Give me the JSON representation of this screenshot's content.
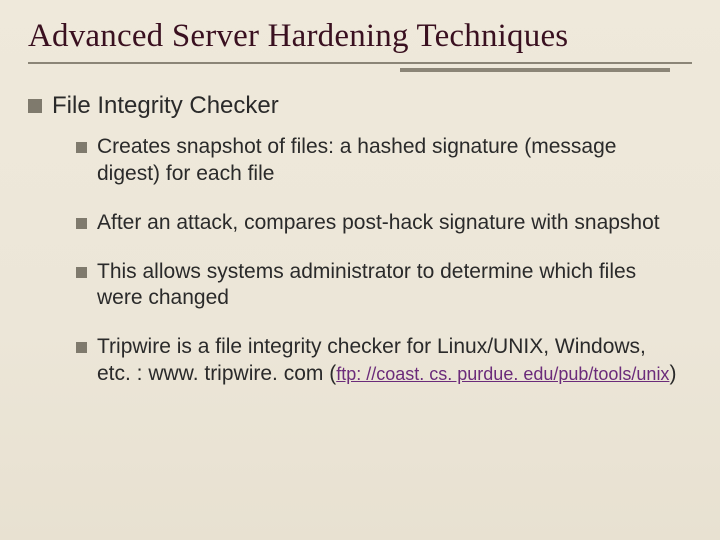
{
  "slide": {
    "title": "Advanced Server Hardening Techniques",
    "topic": "File Integrity Checker",
    "points": [
      "Creates snapshot of files: a hashed signature (message digest) for each file",
      "After an attack, compares post-hack signature with snapshot",
      "This allows systems administrator to determine which files were changed"
    ],
    "tripwire_text": "Tripwire is a file integrity checker for Linux/UNIX, Windows, etc. : www. tripwire. com",
    "tripwire_ref": "ftp: //coast. cs. purdue. edu/pub/tools/unix"
  }
}
